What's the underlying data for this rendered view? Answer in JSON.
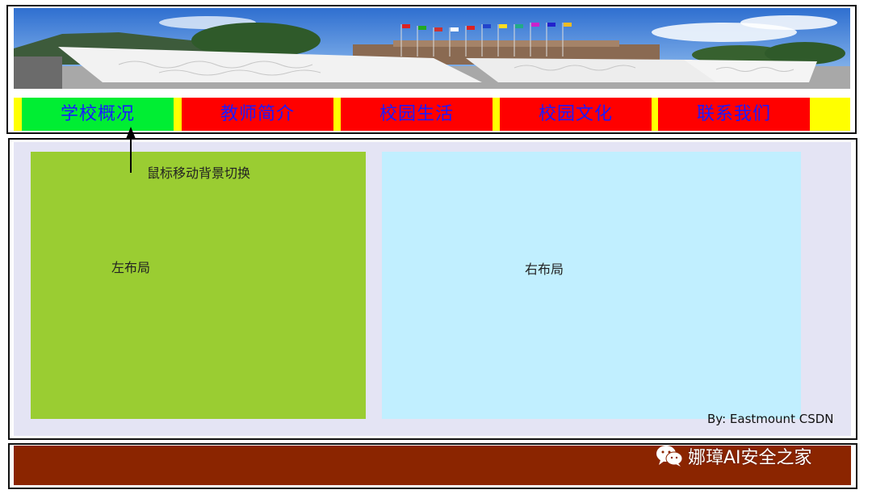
{
  "header": {
    "banner_alt": "campus-banner"
  },
  "nav": {
    "items": [
      {
        "label": "学校概况",
        "active": true
      },
      {
        "label": "教师简介",
        "active": false
      },
      {
        "label": "校园生活",
        "active": false
      },
      {
        "label": "校园文化",
        "active": false
      },
      {
        "label": "联系我们",
        "active": false
      }
    ],
    "colors": {
      "bar": "#ffff00",
      "item": "#ff0000",
      "active": "#00ee33",
      "text": "#1a1aff"
    }
  },
  "annotation": {
    "text": "鼠标移动背景切换"
  },
  "main": {
    "left_label": "左布局",
    "right_label": "右布局",
    "colors": {
      "panel": "#e4e4f4",
      "left": "#9acd32",
      "right": "#c1efff"
    }
  },
  "byline": "By: Eastmount CSDN",
  "footer": {
    "watermark": "娜璋AI安全之家",
    "color": "#8b2500"
  }
}
